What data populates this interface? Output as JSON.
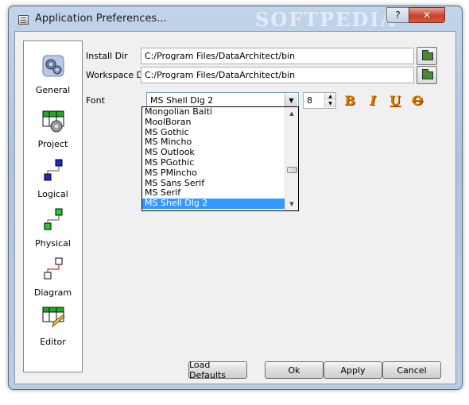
{
  "window": {
    "title": "Application Preferences...",
    "watermark": "SOFTPEDIA",
    "help_label": "?",
    "close_label": "✕"
  },
  "sidebar": {
    "items": [
      {
        "label": "General",
        "icon": "gears-icon"
      },
      {
        "label": "Project",
        "icon": "project-table-icon"
      },
      {
        "label": "Logical",
        "icon": "logical-model-icon"
      },
      {
        "label": "Physical",
        "icon": "physical-model-icon"
      },
      {
        "label": "Diagram",
        "icon": "diagram-icon"
      },
      {
        "label": "Editor",
        "icon": "editor-pencil-icon"
      }
    ]
  },
  "general": {
    "install_dir_label": "Install Dir",
    "install_dir_value": "C:/Program Files/DataArchitect/bin",
    "workspace_dir_label": "Workspace Dir",
    "workspace_dir_value": "C:/Program Files/DataArchitect/bin",
    "font_label": "Font",
    "font_value": "MS Shell Dlg 2",
    "font_size_value": "8",
    "font_options": [
      "Mongolian Baiti",
      "MoolBoran",
      "MS Gothic",
      "MS Mincho",
      "MS Outlook",
      "MS PGothic",
      "MS PMincho",
      "MS Sans Serif",
      "MS Serif",
      "MS Shell Dlg 2"
    ],
    "selected_option_index": 9,
    "style_buttons": {
      "bold": "B",
      "italic": "I",
      "underline": "U",
      "strike": "O"
    }
  },
  "footer": {
    "load_defaults": "Load Defaults",
    "ok": "Ok",
    "apply": "Apply",
    "cancel": "Cancel"
  },
  "colors": {
    "selection": "#3399ff",
    "style_icon": "#e07800",
    "folder_icon": "#4a8a28"
  }
}
